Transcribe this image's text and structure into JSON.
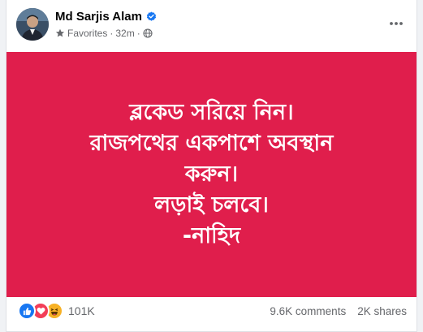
{
  "post": {
    "author": "Md Sarjis Alam",
    "audience": "Favorites",
    "time": "32m",
    "separator": "·",
    "image_lines": [
      "ব্লকেড সরিয়ে নিন।",
      "রাজপথের একপাশে অবস্থান",
      "করুন।",
      "লড়াই চলবে।",
      "-নাহিদ"
    ],
    "image_bg": "#e01e4c",
    "reactions": {
      "icons": [
        "like-icon",
        "love-icon",
        "haha-icon"
      ],
      "count": "101K"
    },
    "comments": "9.6K comments",
    "shares": "2K shares"
  },
  "colors": {
    "like": "#1877f2",
    "love": "#f33e58",
    "haha": "#f7b125",
    "verified": "#1877f2"
  }
}
